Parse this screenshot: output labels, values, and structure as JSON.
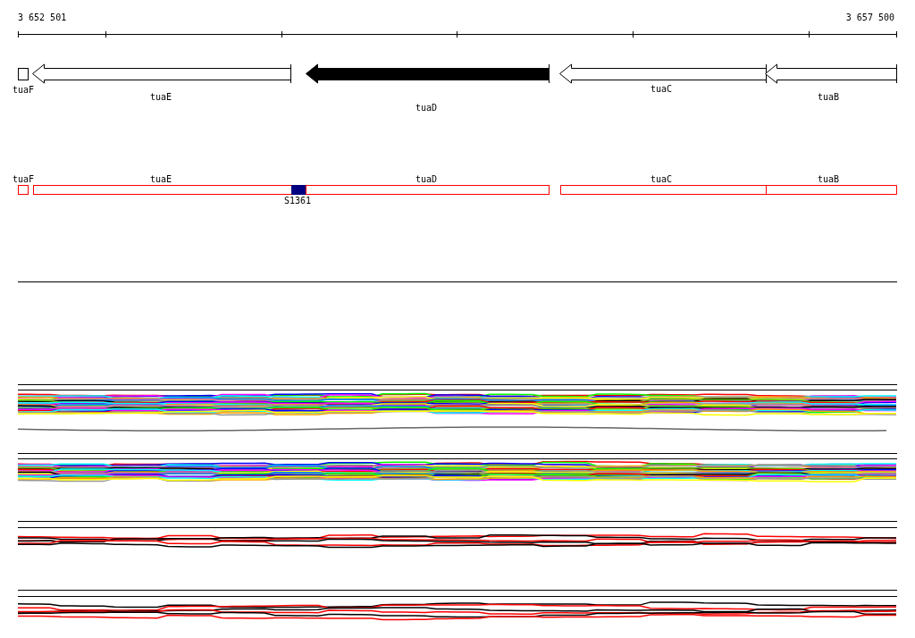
{
  "ruler": {
    "start_label": "3 652 501",
    "end_label": "3 657 500"
  },
  "genes": [
    {
      "name": "tuaF",
      "kind": "box",
      "selected": false
    },
    {
      "name": "tuaE",
      "kind": "arrow",
      "selected": false
    },
    {
      "name": "tuaD",
      "kind": "arrow",
      "selected": true
    },
    {
      "name": "tuaC",
      "kind": "arrow",
      "selected": false
    },
    {
      "name": "tuaB",
      "kind": "arrow",
      "selected": false
    }
  ],
  "feature_track": {
    "labels": [
      "tuaF",
      "tuaE",
      "tuaD",
      "tuaC",
      "tuaB"
    ],
    "segment": {
      "label": "S1361"
    }
  }
}
